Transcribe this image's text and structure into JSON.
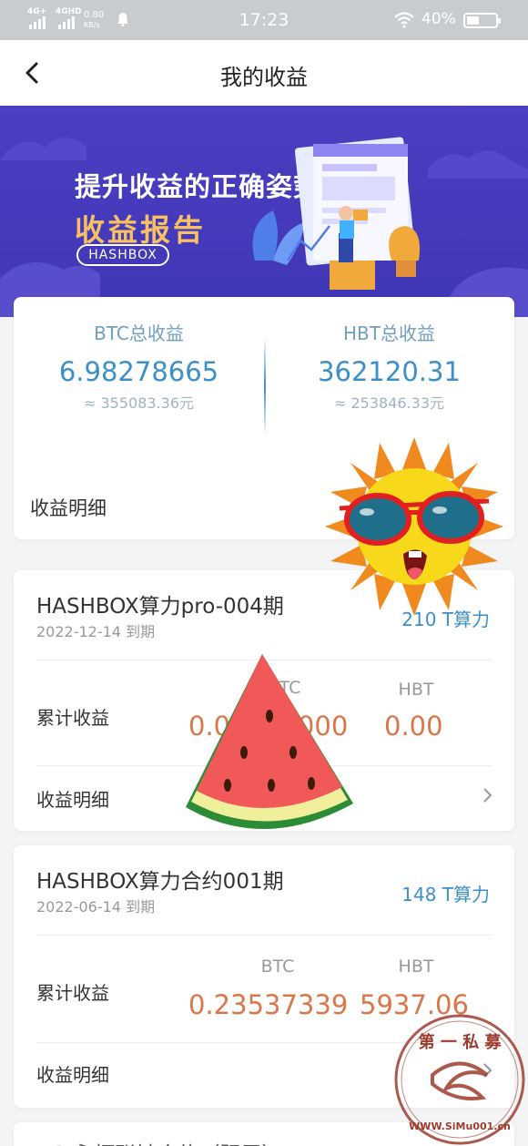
{
  "status": {
    "signal_1": "4G+",
    "signal_2": "4GHD",
    "speed_value": "0.80",
    "speed_unit": "KB/s",
    "time": "17:23",
    "battery_pct": "40%"
  },
  "nav": {
    "title": "我的收益",
    "back_icon": "chevron-left-icon"
  },
  "banner": {
    "headline": "提升收益的正确姿势",
    "subhead": "收益报告",
    "tag": "HASHBOX"
  },
  "summary": {
    "btc": {
      "label": "BTC总收益",
      "value": "6.98278665",
      "cny": "≈ 355083.36元"
    },
    "hbt": {
      "label": "HBT总收益",
      "value": "362120.31",
      "cny": "≈ 253846.33元"
    },
    "detail_label": "收益明细"
  },
  "orders": [
    {
      "name": "HASHBOX算力pro-004期",
      "due": "2022-12-14 到期",
      "power_visible": "210 T算力",
      "accumulated_label": "累计收益",
      "btc_label": "BTC",
      "hbt_label": "HBT",
      "btc_value": "0.00000000",
      "hbt_value": "0.00",
      "detail_label": "收益明细"
    },
    {
      "name": "HASHBOX算力合约001期",
      "due": "2022-06-14 到期",
      "power_visible": "148 T算力",
      "accumulated_label": "累计收益",
      "btc_label": "BTC",
      "hbt_label": "HBT",
      "btc_value": "0.23537339",
      "hbt_value": "5937.06",
      "detail_label": "收益明细"
    }
  ],
  "partial_card_title": "BG 永恒联姑合约（阴层）",
  "stamp": {
    "text_top": "第 一 私 募",
    "text_bottom": "WWW.SiMu001.cn"
  },
  "colors": {
    "accent_blue": "#3c8fc7",
    "amount_orange": "#d9774a",
    "banner_purple": "#4337b8",
    "banner_gold": "#f7c063"
  }
}
